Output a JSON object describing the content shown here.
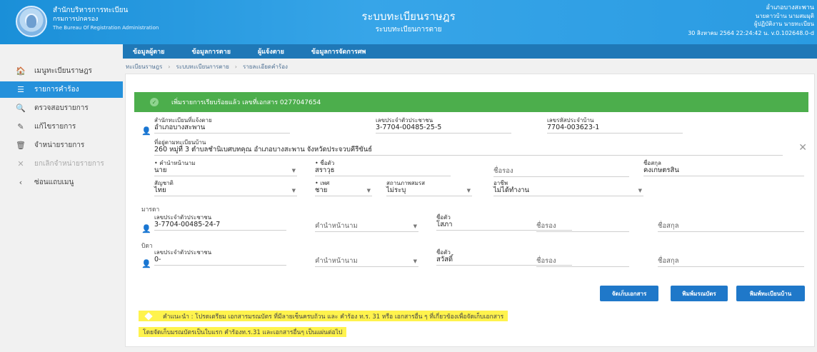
{
  "header": {
    "org_th": "สำนักบริหารการทะเบียน",
    "org_dept": "กรมการปกครอง",
    "org_en": "The Bureau Of Registration Administration",
    "system_title": "ระบบทะเบียนราษฎร",
    "system_subtitle": "ระบบทะเบียนการตาย",
    "user_office": "อำเภอบางสะพาน",
    "user_name": "นายดาวบ้าน นามสมมุติ",
    "user_role": "ผู้ปฏิบัติงาน นายทะเบียน",
    "user_date": "30 สิงหาคม 2564 22:24:42 น. v.0.102648.0-d"
  },
  "tabs": [
    "ข้อมูลผู้ตาย",
    "ข้อมูลการตาย",
    "ผู้แจ้งตาย",
    "ข้อมูลการจัดการศพ"
  ],
  "breadcrumb": [
    "ทะเบียนราษฎร",
    "ระบบทะเบียนการตาย",
    "รายละเอียดคำร้อง"
  ],
  "menu": [
    {
      "label": "เมนูทะเบียนราษฎร",
      "icon": "home-icon",
      "glyph": "🏠",
      "state": "normal"
    },
    {
      "label": "รายการคำร้อง",
      "icon": "list-icon",
      "glyph": "☰",
      "state": "active"
    },
    {
      "label": "ตรวจสอบรายการ",
      "icon": "search-icon",
      "glyph": "🔍",
      "state": "normal"
    },
    {
      "label": "แก้ไขรายการ",
      "icon": "pencil-icon",
      "glyph": "✎",
      "state": "normal"
    },
    {
      "label": "จำหน่ายรายการ",
      "icon": "trash-icon",
      "glyph": "🗑",
      "state": "normal"
    },
    {
      "label": "ยกเลิกจำหน่ายรายการ",
      "icon": "cancel-icon",
      "glyph": "✕",
      "state": "disabled"
    },
    {
      "label": "ซ่อนแถบเมนู",
      "icon": "chevron-left-icon",
      "glyph": "‹",
      "state": "normal"
    }
  ],
  "alert": {
    "message": "เพิ่มรายการเรียบร้อยแล้ว เลขที่เอกสาร 0277047654",
    "color": "#4cae4c"
  },
  "deceased": {
    "office_label": "สำนักทะเบียนที่แจ้งตาย",
    "office_value": "อำเภอบางสะพาน",
    "id_label": "เลขประจำตัวประชาชน",
    "id_value": "3-7704-00485-25-5",
    "house_label": "เลขรหัสประจำบ้าน",
    "house_value": "7704-003623-1",
    "address_label": "ที่อยู่ตามทะเบียนบ้าน",
    "address_value": "260 หมู่ที่ 3 ตำบลชำนิเบศบทคุณ อำเภอบางสะพาน จังหวัดประจวบคีรีขันธ์",
    "title_label": "คำนำหน้านาม",
    "title_value": "นาย",
    "first_label": "ชื่อตัว",
    "first_value": "สราวุธ",
    "middle_label": "ชื่อรอง",
    "last_label": "ชื่อสกุล",
    "last_value": "คงเกษตรสิน",
    "nationality_label": "สัญชาติ",
    "nationality_value": "ไทย",
    "sex_label": "เพศ",
    "sex_value": "ชาย",
    "marital_label": "สถานภาพสมรส",
    "marital_value": "ไม่ระบุ",
    "occupation_label": "อาชีพ",
    "occupation_value": "ไม่ได้ทำงาน"
  },
  "mother": {
    "section": "มารดา",
    "id_label": "เลขประจำตัวประชาชน",
    "id_value": "3-7704-00485-24-7",
    "title_placeholder": "คำนำหน้านาม",
    "first_label": "ชื่อตัว",
    "first_value": "โสภา",
    "middle_placeholder": "ชื่อรอง",
    "last_placeholder": "ชื่อสกุล"
  },
  "father": {
    "section": "บิดา",
    "id_label": "เลขประจำตัวประชาชน",
    "id_value": "0-",
    "title_placeholder": "คำนำหน้านาม",
    "first_label": "ชื่อตัว",
    "first_value": "สวัสดิ์",
    "middle_placeholder": "ชื่อรอง",
    "last_placeholder": "ชื่อสกุล"
  },
  "buttons": {
    "store_docs": "จัดเก็บเอกสาร",
    "print_certificate": "พิมพ์มรณบัตร",
    "print_house": "พิมพ์ทะเบียนบ้าน"
  },
  "notes": {
    "note1": "คำแนะนำ : โปรดเตรียม เอกสารมรณบัตร ที่มีลายเซ็นครบถ้วน และ คำร้อง ท.ร. 31 หรือ เอกสารอื่น ๆ ที่เกี่ยวข้องเพื่อจัดเก็บเอกสาร",
    "note2": "โดยจัดเก็บมรณบัตรเป็นใบแรก คำร้องท.ร.31 และเอกสารอื่นๆ เป็นแผ่นต่อไป",
    "highlight_color": "#fff34d"
  }
}
